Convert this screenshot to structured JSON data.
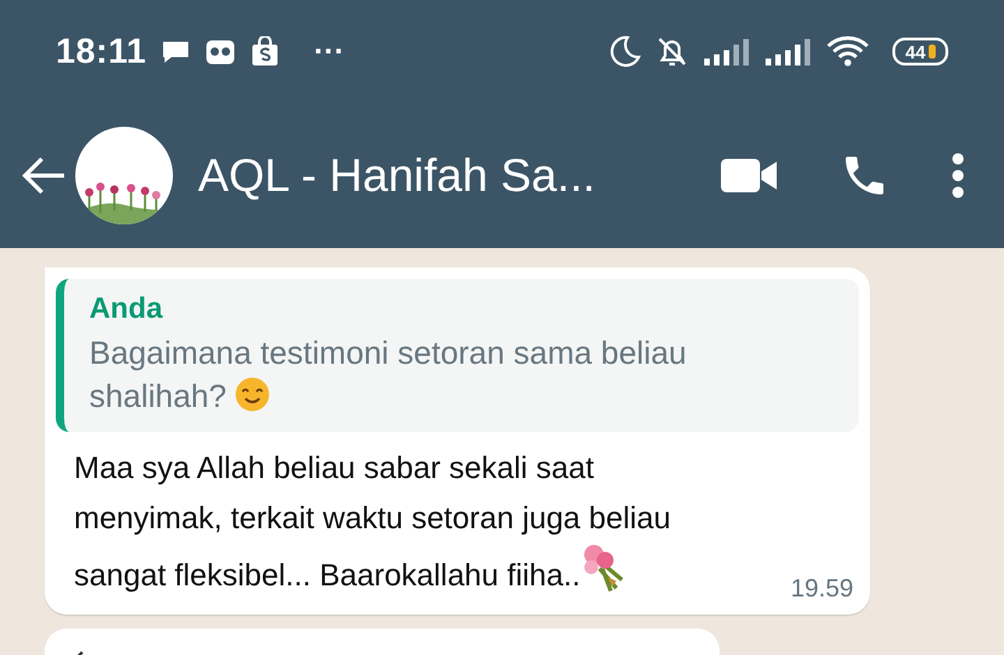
{
  "status_bar": {
    "time": "18:11",
    "battery": "44",
    "more": "···"
  },
  "header": {
    "title": "AQL - Hanifah Sa..."
  },
  "message": {
    "quote": {
      "author": "Anda",
      "text": "Bagaimana testimoni setoran sama beliau shalihah?"
    },
    "text": "Maa sya Allah beliau sabar sekali saat menyimak, terkait waktu setoran juga beliau sangat fleksibel... Baarokallahu fiiha..",
    "time": "19.59"
  }
}
